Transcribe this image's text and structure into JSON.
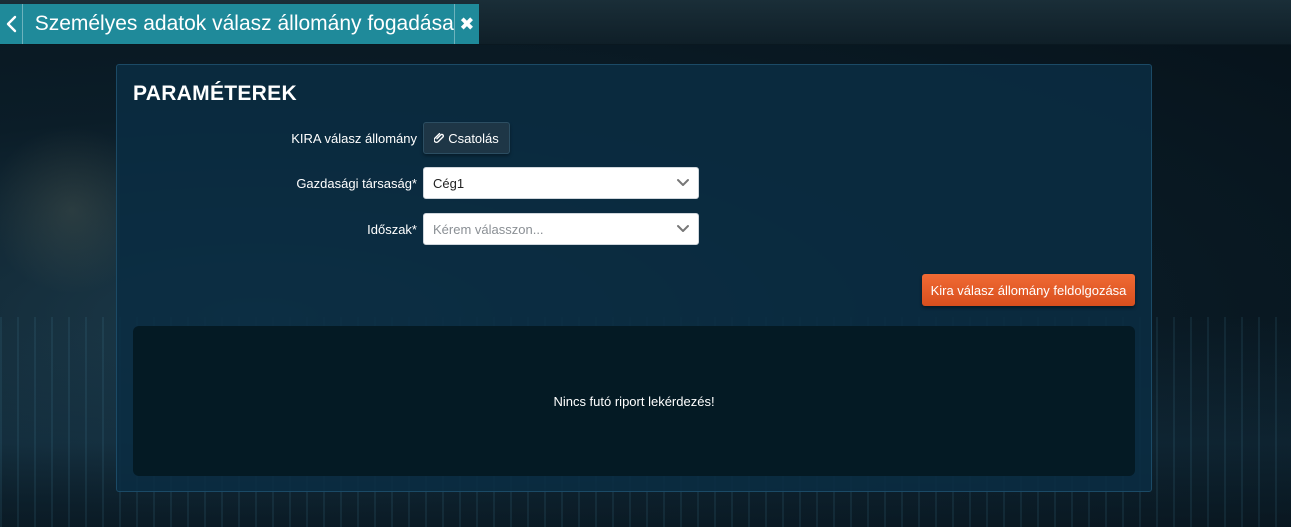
{
  "tab": {
    "title": "Személyes adatok válasz állomány fogadása",
    "close_glyph": "✖",
    "icons": {
      "back": "chevron-left-icon",
      "close": "close-icon"
    }
  },
  "panel": {
    "title": "PARAMÉTEREK",
    "fields": {
      "kira_file": {
        "label": "KIRA válasz állomány",
        "button_label": "Csatolás",
        "icon": "paperclip-icon"
      },
      "company": {
        "label": "Gazdasági társaság*",
        "value": "Cég1",
        "icon": "chevron-down-icon"
      },
      "period": {
        "label": "Időszak*",
        "placeholder": "Kérem válasszon...",
        "icon": "chevron-down-icon"
      }
    },
    "process_button_label": "Kira válasz állomány feldolgozása",
    "report_message": "Nincs futó riport lekérdezés!"
  },
  "colors": {
    "tab_bg": "#1f8a9a",
    "panel_bg": "#0a2c42",
    "accent_orange": "#e85c28",
    "report_bg": "#041a24"
  }
}
